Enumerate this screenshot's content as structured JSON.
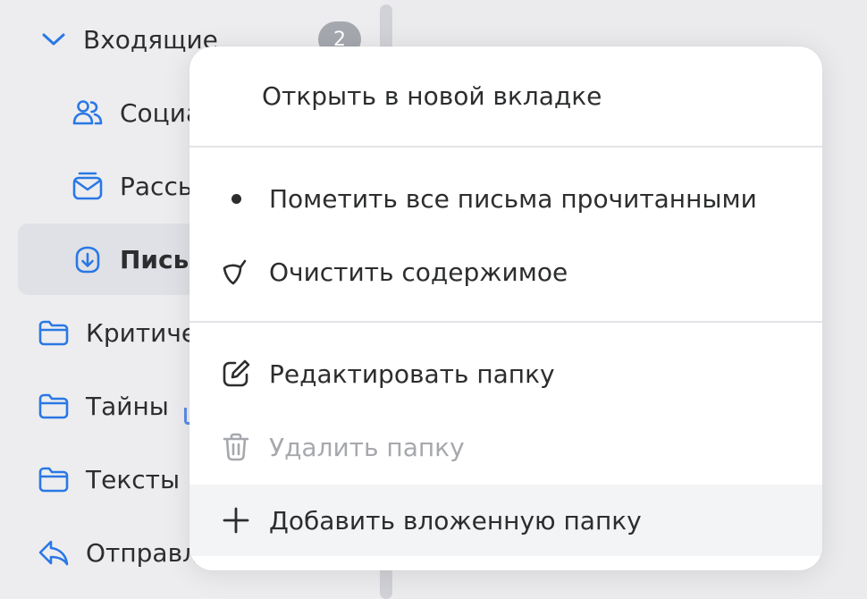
{
  "sidebar": {
    "inbox_label": "Входящие",
    "inbox_count": "2",
    "social_label": "Социа",
    "newsletters_label": "Рассы",
    "letters_label": "Письм",
    "critical_label": "Критиче",
    "secrets_label": "Тайны",
    "texts_label": "Тексты в",
    "sent_label": "Отправл"
  },
  "menu": {
    "open_new_tab": "Открыть в новой вкладке",
    "mark_all_read": "Пометить все письма прочитанными",
    "clear_contents": "Очистить содержимое",
    "edit_folder": "Редактировать папку",
    "delete_folder": "Удалить папку",
    "add_subfolder": "Добавить вложенную папку"
  },
  "colors": {
    "accent": "#2a78e4",
    "text": "#2c2d2e",
    "disabled": "#a6a8ad",
    "badge": "#a5a8ae",
    "active_row": "#e0e1e6"
  }
}
